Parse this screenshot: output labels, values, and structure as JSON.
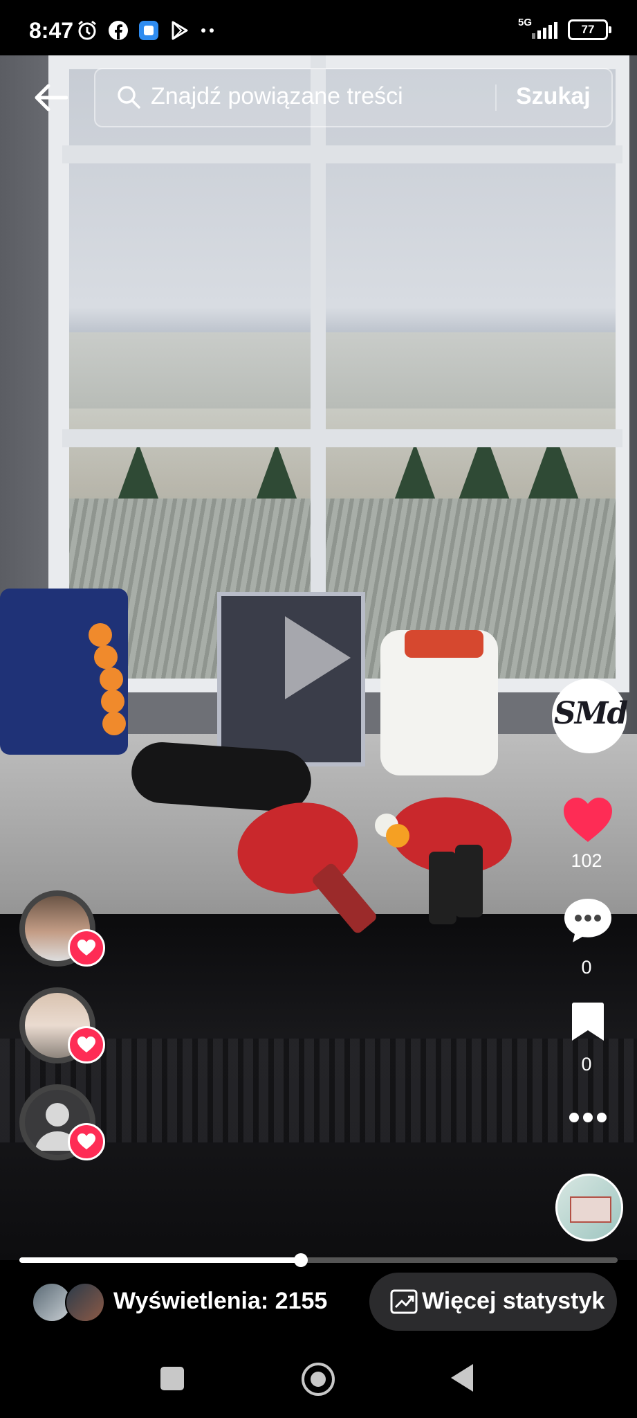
{
  "status_bar": {
    "time": "8:47",
    "network": "5G",
    "battery": "77"
  },
  "search": {
    "placeholder": "Znajdź powiązane treści",
    "button_label": "Szukaj"
  },
  "creator": {
    "logo_text": "SMd"
  },
  "actions": {
    "likes": "102",
    "comments": "0",
    "saves": "0"
  },
  "video": {
    "progress": 0.47
  },
  "stats": {
    "views_label": "Wyświetlenia: 2155",
    "more_stats_label": "Więcej statystyk"
  },
  "colors": {
    "like": "#fe2c55",
    "background": "#000000"
  }
}
